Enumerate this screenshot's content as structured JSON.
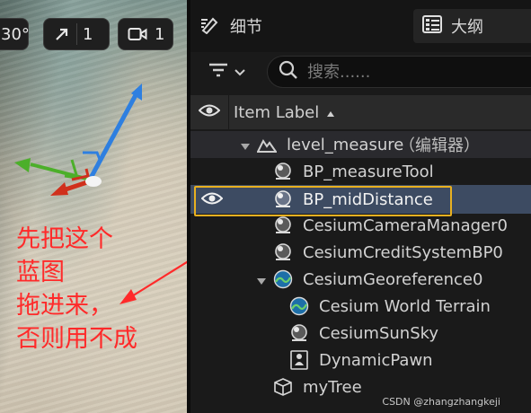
{
  "viewport": {
    "fov_value": "30°",
    "scale_value": "1",
    "camera_speed_value": "1",
    "annotation_lines": [
      "先把这个",
      "蓝图",
      "拖进来，",
      "否则用不成"
    ]
  },
  "tabs": {
    "details_label": "细节",
    "outliner_label": "大纲"
  },
  "search": {
    "placeholder": "搜索......"
  },
  "outliner": {
    "header_label": "Item Label",
    "level": {
      "name": "level_measure",
      "suffix": "（编辑器）"
    },
    "items": [
      {
        "label": "BP_measureTool",
        "icon": "sphere-actor-icon",
        "selected": false
      },
      {
        "label": "BP_midDistance",
        "icon": "sphere-actor-icon",
        "selected": true
      },
      {
        "label": "CesiumCameraManager0",
        "icon": "sphere-actor-icon",
        "selected": false
      },
      {
        "label": "CesiumCreditSystemBP0",
        "icon": "sphere-actor-icon",
        "selected": false
      },
      {
        "label": "CesiumGeoreference0",
        "icon": "cesium-georeference-icon",
        "selected": false,
        "expanded": true
      },
      {
        "label": "Cesium World Terrain",
        "icon": "cesium-terrain-icon",
        "selected": false
      },
      {
        "label": "CesiumSunSky",
        "icon": "sphere-actor-icon",
        "selected": false
      },
      {
        "label": "DynamicPawn",
        "icon": "pawn-icon",
        "selected": false
      },
      {
        "label": "myTree",
        "icon": "mesh-cube-icon",
        "selected": false
      }
    ]
  },
  "watermark": "CSDN @zhangzhangkeji",
  "colors": {
    "selection_bg": "#3d4b62",
    "selection_outline": "#e8b020",
    "annotation_red": "#ff2a2a",
    "gizmo_x": "#d0301c",
    "gizmo_y": "#4caf2a",
    "gizmo_z": "#2e7fe0"
  }
}
